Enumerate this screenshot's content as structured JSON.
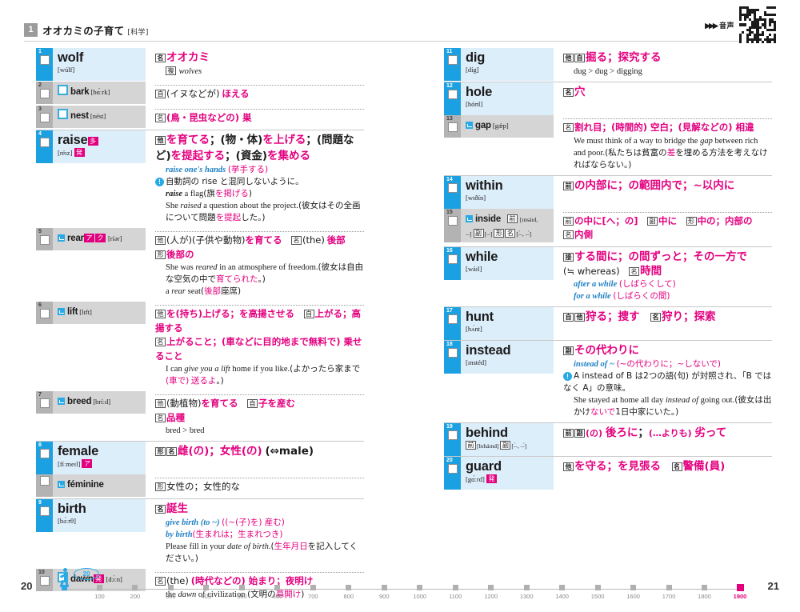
{
  "header": {
    "section_number": "1",
    "section_title": "オオカミの子育て",
    "section_tag": "[科学]",
    "audio_label": "音声",
    "audio_arrows": "▶▶▶"
  },
  "footer": {
    "left_page": "20",
    "right_page": "21",
    "runner_bubble": "20",
    "ticks": [
      "0",
      "100",
      "200",
      "300",
      "400",
      "500",
      "600",
      "700",
      "800",
      "900",
      "1000",
      "1100",
      "1200",
      "1300",
      "1400",
      "1500",
      "1600",
      "1700",
      "1800",
      "1900"
    ],
    "current_tick": "1900",
    "accent_color": "#e3007f",
    "blue_color": "#29a9e6"
  },
  "columns": {
    "left": [
      {
        "type": "main",
        "num": "1",
        "headword": "wolf",
        "pron": "[wúlf]",
        "defs": [
          {
            "cls": "dl big",
            "html": "<span class='pos'>名</span><span class='mag-b jp'>オオカミ</span>"
          },
          {
            "cls": "ex",
            "html": "<span class='pos'>複</span> <span class='it'>wolves</span>"
          }
        ]
      },
      {
        "type": "sub",
        "num": "2",
        "headword": "bark",
        "pron": "[bɑ́ːrk]",
        "icon": "hollow-square",
        "rule": "dotted",
        "defs": [
          {
            "cls": "dl",
            "html": "<span class='pos'>自</span><span class='jp'>(イヌなどが)</span> <span class='mag-b jp'>ほえる</span>"
          }
        ]
      },
      {
        "type": "sub",
        "num": "3",
        "headword": "nest",
        "pron": "[nést]",
        "icon": "hollow-square",
        "rule": "dotted",
        "defs": [
          {
            "cls": "dl",
            "html": "<span class='pos'>名</span><span class='mag-b jp'>(鳥・昆虫などの) 巣</span>"
          }
        ]
      },
      {
        "type": "main",
        "num": "4",
        "headword": "raise",
        "pron": "[réɪz]",
        "rule": "solid",
        "badges": [
          "多"
        ],
        "pron_badges": [
          "発"
        ],
        "defs": [
          {
            "cls": "dl big",
            "html": "<span class='pos'>他</span><span class='mag-b jp'>を育てる</span><span class='jp'>；(物・体)</span><span class='mag-b jp'>を上げる</span><span class='jp'>；(問題など)</span><span class='mag-b jp'>を提起する</span><span class='jp'>；(資金)</span><span class='mag-b jp'>を集める</span>"
          },
          {
            "cls": "ex",
            "html": "<span class='blu-i'>raise one's hands</span> <span class='mag jp'>(挙手する)</span>"
          },
          {
            "cls": "note",
            "html": "<span class='infoi'>!</span><span class='jp'>自動詞の rise と混同しないように。</span>"
          },
          {
            "cls": "ex",
            "html": "<span class='it'><b>raise</b></span> a flag<span class='jp'>(旗</span><span class='mag jp'>を掲げる</span><span class='jp'>)</span>"
          },
          {
            "cls": "ex",
            "html": "She <span class='it'>raised</span> a question about the project.<span class='jp'>(彼女はその全画について問題</span><span class='mag jp'>を提起</span><span class='jp'>した。)</span>"
          }
        ]
      },
      {
        "type": "sub",
        "num": "5",
        "headword": "rear",
        "pron": "[ríər]",
        "icon": "blue-square",
        "rule": "dotted",
        "badges": [
          "ア",
          "ク"
        ],
        "defs": [
          {
            "cls": "dl",
            "html": "<span class='pos'>他</span><span class='jp'>(人が)(子供や動物)</span><span class='mag-b jp'>を育てる</span>　<span class='pos'>名</span><span class='jp'>(the)</span> <span class='mag-b jp'>後部</span>"
          },
          {
            "cls": "dl",
            "html": "<span class='pos'>形</span><span class='mag-b jp'>後部の</span>"
          },
          {
            "cls": "ex",
            "html": "She was <span class='it'>reared</span> in an atmosphere of freedom.<span class='jp'>(彼女は自由な空気の中で</span><span class='mag jp'>育てられた</span><span class='jp'>。)</span>"
          },
          {
            "cls": "ex",
            "html": "a <span class='it'>rear</span> seat<span class='jp'>(</span><span class='mag jp'>後部</span><span class='jp'>座席)</span>"
          }
        ]
      },
      {
        "type": "sub",
        "num": "6",
        "headword": "lift",
        "pron": "[lɪft]",
        "icon": "blue-square",
        "rule": "dotted",
        "defs": [
          {
            "cls": "dl",
            "html": "<span class='pos'>他</span><span class='mag-b jp'>を(持ち)上げる；を高揚させる</span>　<span class='pos'>自</span><span class='mag-b jp'>上がる；高揚する</span>"
          },
          {
            "cls": "dl",
            "html": "<span class='pos'>名</span><span class='mag-b jp'>上がること；(車などに目的地まで無料で) 乗せること</span>"
          },
          {
            "cls": "ex",
            "html": "I can <span class='it'>give you a lift</span> home if you like.<span class='jp'>(よかったら家まで</span><span class='mag jp'>(車で)</span> <span class='mag jp'>送るよ</span><span class='jp'>。)</span>"
          }
        ]
      },
      {
        "type": "sub",
        "num": "7",
        "headword": "breed",
        "pron": "[bríːd]",
        "icon": "blue-square",
        "rule": "dotted",
        "defs": [
          {
            "cls": "dl",
            "html": "<span class='pos'>他</span><span class='jp'>(動植物)</span><span class='mag-b jp'>を育てる</span>　<span class='pos'>自</span><span class='mag-b jp'>子を産む</span>"
          },
          {
            "cls": "dl",
            "html": "<span class='pos'>名</span><span class='mag-b jp'>品種</span>"
          },
          {
            "cls": "ex",
            "html": "bred &gt; bred"
          }
        ]
      },
      {
        "type": "main",
        "num": "8",
        "headword": "female",
        "pron": "[fíːmeɪl]",
        "rule": "solid",
        "pron_badges": [
          "ア"
        ],
        "defs": [
          {
            "cls": "dl big",
            "html": "<span class='pos'>形</span><span class='pos'>名</span><span class='mag-b jp'>雌(の)；女性(の)</span> <span class='jp'>(⇔male)</span>"
          }
        ]
      },
      {
        "type": "sub-plain",
        "num": "",
        "headword": "féminine",
        "pron": "",
        "icon": "blue-square",
        "rule": "dotted",
        "defs": [
          {
            "cls": "dl",
            "html": "<span class='pos'>形</span><span class='jp'>女性の；女性的な</span>"
          }
        ]
      },
      {
        "type": "main",
        "num": "9",
        "headword": "birth",
        "pron": "[bə́ːrθ]",
        "rule": "solid",
        "defs": [
          {
            "cls": "dl big",
            "html": "<span class='pos'>名</span><span class='mag-b jp'>誕生</span>"
          },
          {
            "cls": "ex",
            "html": "<span class='blu-i'>give birth (to ~)</span> <span class='mag jp'>((~(子)を) 産む)</span>"
          },
          {
            "cls": "ex",
            "html": "<span class='blu-i'>by birth</span><span class='mag jp'>(生まれは；生まれつき)</span>"
          },
          {
            "cls": "ex",
            "html": "Please fill in your <span class='it'>date of birth</span>.<span class='jp'>(</span><span class='mag jp'>生年月日</span><span class='jp'>を記入してください。)</span>"
          }
        ]
      },
      {
        "type": "sub",
        "num": "10",
        "headword": "dawn",
        "pron": "[dɔ́ːn]",
        "icon": "hollow-square",
        "rule": "dotted",
        "badges": [
          "発"
        ],
        "defs": [
          {
            "cls": "dl",
            "html": "<span class='pos'>名</span><span class='jp'>(the)</span> <span class='mag-b jp'>(時代などの) 始まり；夜明け</span>"
          },
          {
            "cls": "ex",
            "html": "the <span class='it'>dawn</span> of civilization <span class='jp'>(文明の</span><span class='mag jp'>幕開け</span><span class='jp'>)</span>"
          }
        ]
      }
    ],
    "right": [
      {
        "type": "main",
        "num": "11",
        "headword": "dig",
        "pron": "[díg]",
        "defs": [
          {
            "cls": "dl big",
            "html": "<span class='pos'>他</span><span class='pos'>自</span><span class='mag-b jp'>掘る；探究する</span>"
          },
          {
            "cls": "ex",
            "html": "dug &gt; dug &gt; digging"
          }
        ]
      },
      {
        "type": "main",
        "num": "12",
        "headword": "hole",
        "pron": "[hóʊl]",
        "rule": "solid",
        "defs": [
          {
            "cls": "dl big",
            "html": "<span class='pos'>名</span><span class='mag-b jp'>穴</span>"
          }
        ]
      },
      {
        "type": "sub",
        "num": "13",
        "headword": "gap",
        "pron": "[gǽp]",
        "icon": "blue-square",
        "rule": "dotted",
        "defs": [
          {
            "cls": "dl",
            "html": "<span class='pos'>名</span><span class='mag-b jp'>割れ目；(時間的) 空白；(見解などの) 相違</span>"
          },
          {
            "cls": "ex",
            "html": "We must think of a way to bridge the <span class='it'>gap</span> between rich and poor.<span class='jp'>(私たちは貧富の</span><span class='mag jp'>差</span><span class='jp'>を埋める方法を考えなければならない。)</span>"
          }
        ]
      },
      {
        "type": "main",
        "num": "14",
        "headword": "within",
        "pron": "[wɪðín]",
        "rule": "solid",
        "defs": [
          {
            "cls": "dl big",
            "html": "<span class='pos'>前</span><span class='mag-b jp'>の内部に；の範囲内で；~以内に</span>"
          }
        ]
      },
      {
        "type": "sub",
        "num": "15",
        "headword": "inside",
        "pron": "",
        "icon": "blue-square",
        "rule": "dotted",
        "pron_lines": [
          "<span class='pos'>前</span> [ɪnsáɪd, ˗˗]",
          "<span class='pos'>副</span>[˗˗] <span class='pos'>形</span><span class='pos'>名</span>[˗́˗, ˗˗́]"
        ],
        "defs": [
          {
            "cls": "dl",
            "html": "<span class='pos'>前</span><span class='mag-b jp'>の中に[へ；の]</span>　<span class='pos'>副</span><span class='mag-b jp'>中に</span>　<span class='pos'>形</span><span class='mag-b jp'>中の；内部の</span>　<span class='pos'>名</span><span class='mag-b jp'>内側</span>"
          }
        ]
      },
      {
        "type": "main",
        "num": "16",
        "headword": "while",
        "pron": "[wáɪl]",
        "rule": "solid",
        "defs": [
          {
            "cls": "dl big",
            "html": "<span class='pos'>接</span><span class='mag-b jp'>する間に；の間ずっと；その一方で</span>"
          },
          {
            "cls": "dl",
            "html": "<span class='jp'>(≒ whereas)</span>　<span class='pos'>名</span><span class='mag-b jp' style='font-size:13.5px'>時間</span>"
          },
          {
            "cls": "ex",
            "html": "<span class='blu-i'>after a while</span> <span class='mag jp'>(しばらくして)</span>"
          },
          {
            "cls": "ex",
            "html": "<span class='blu-i'>for a while</span> <span class='mag jp'>(しばらくの間)</span>"
          }
        ]
      },
      {
        "type": "main",
        "num": "17",
        "headword": "hunt",
        "pron": "[hʌ́nt]",
        "rule": "solid",
        "defs": [
          {
            "cls": "dl big",
            "html": "<span class='pos'>自</span><span class='pos'>他</span><span class='mag-b jp'>狩る；捜す</span>　<span class='pos'>名</span><span class='mag-b jp'>狩り；探索</span>"
          }
        ]
      },
      {
        "type": "main",
        "num": "18",
        "headword": "instead",
        "pron": "[ɪnstéd]",
        "rule": "solid",
        "defs": [
          {
            "cls": "dl big",
            "html": "<span class='pos'>副</span><span class='mag-b jp'>その代わりに</span>"
          },
          {
            "cls": "ex",
            "html": "<span class='blu-i'>instead of ~</span> <span class='mag jp'>(~の代わりに；~しないで)</span>"
          },
          {
            "cls": "note",
            "html": "<span class='infoi'>!</span><span class='jp'>A instead of B は2つの語(句) が対照され、「B ではなく A」の意味。</span>"
          },
          {
            "cls": "ex",
            "html": "She stayed at home all day <span class='it'>instead of</span> going out.<span class='jp'>(彼女は出かけ</span><span class='mag jp'>ないで</span><span class='jp'>1日中家にいた。)</span>"
          }
        ]
      },
      {
        "type": "main",
        "num": "19",
        "headword": "behind",
        "pron": "",
        "rule": "solid",
        "pron_lines": [
          "<span class='pos'>前</span>[bɪháɪnd] <span class='pos'>副</span>[˗́˗, ˗˗́]"
        ],
        "defs": [
          {
            "cls": "dl big",
            "html": "<span class='pos'>前</span><span class='pos'>副</span><span class='mag jp' style='font-size:11px'>(の)</span> <span class='mag-b jp'>後ろに</span><span class='jp'>；</span><span class='mag jp' style='font-size:11px'>(…よりも)</span> <span class='mag-b jp'>劣って</span>"
          }
        ]
      },
      {
        "type": "main",
        "num": "20",
        "headword": "guard",
        "pron": "[gɑ́ːrd]",
        "rule": "solid",
        "pron_badges": [
          "発"
        ],
        "defs": [
          {
            "cls": "dl big",
            "html": "<span class='pos'>他</span><span class='mag-b jp'>を守る；を見張る</span>　<span class='pos'>名</span><span class='mag-b jp'>警備(員)</span>"
          }
        ]
      }
    ]
  }
}
